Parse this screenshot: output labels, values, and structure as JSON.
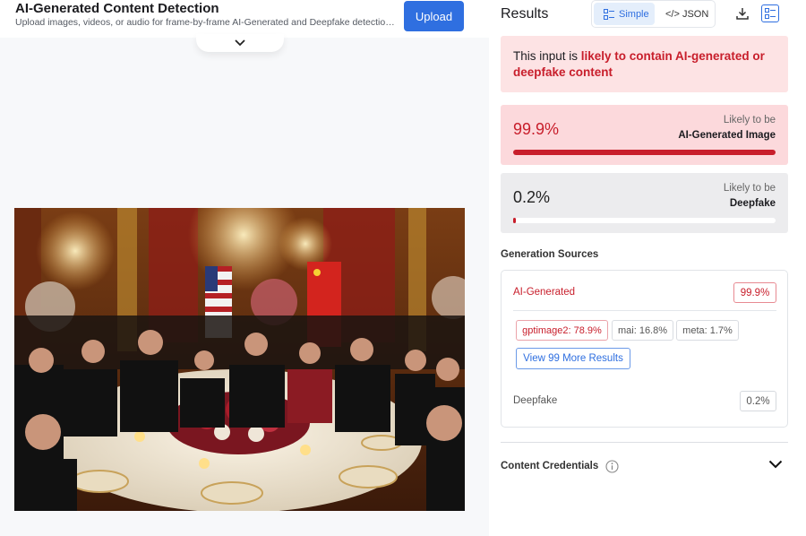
{
  "header": {
    "title": "AI-Generated Content Detection",
    "subtitle": "Upload images, videos, or audio for frame-by-frame AI-Generated and Deepfake detection with...",
    "upload_label": "Upload"
  },
  "results": {
    "label": "Results",
    "view_toggle": {
      "simple_label": "Simple",
      "json_label": "</> JSON",
      "selected": "Simple"
    },
    "verdict": {
      "prefix": "This input is ",
      "emphasis": "likely to contain AI-generated or deepfake content"
    },
    "ai_card": {
      "percent": "99.9%",
      "likely": "Likely to be",
      "kind": "AI-Generated Image",
      "fraction": 0.999
    },
    "deepfake_card": {
      "percent": "0.2%",
      "likely": "Likely to be",
      "kind": "Deepfake",
      "fraction": 0.002
    },
    "generation_sources": {
      "label": "Generation Sources",
      "ai": {
        "name": "AI-Generated",
        "percent": "99.9%"
      },
      "tags": [
        "gptimage2: 78.9%",
        "mai: 16.8%",
        "meta: 1.7%"
      ],
      "more_label": "View 99 More Results",
      "deepfake": {
        "name": "Deepfake",
        "percent": "0.2%"
      }
    },
    "content_credentials_label": "Content Credentials"
  },
  "colors": {
    "accent": "#2f6fe0",
    "alert": "#c81e2b",
    "alert_bg": "#fde3e4"
  }
}
